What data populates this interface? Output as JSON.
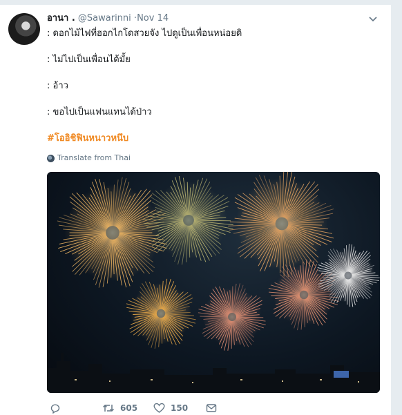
{
  "tweet": {
    "display_name": "อานา .",
    "handle": "@Sawarinni",
    "separator": "·",
    "time": "Nov 14",
    "lines": [
      ": ดอกไม้ไฟที่ฮอกไกโดสวยจัง ไปดูเป็นเพื่อนหน่อยดิ",
      ": ไม่ไปเป็นเพื่อนได้มั้ย",
      ": อ้าว",
      ": ขอไปเป็นแฟนแทนได้ป่าว"
    ],
    "hashtag": "#โออิชิฟินหนาวหนึบ",
    "translate_label": "Translate from Thai",
    "media_icon": "fireworks-photo",
    "hashtag_color": "#f08a24"
  },
  "actions": {
    "reply_icon": "reply-icon",
    "retweet_icon": "retweet-icon",
    "retweet_count": "605",
    "like_icon": "heart-icon",
    "like_count": "150",
    "dm_icon": "envelope-icon"
  }
}
